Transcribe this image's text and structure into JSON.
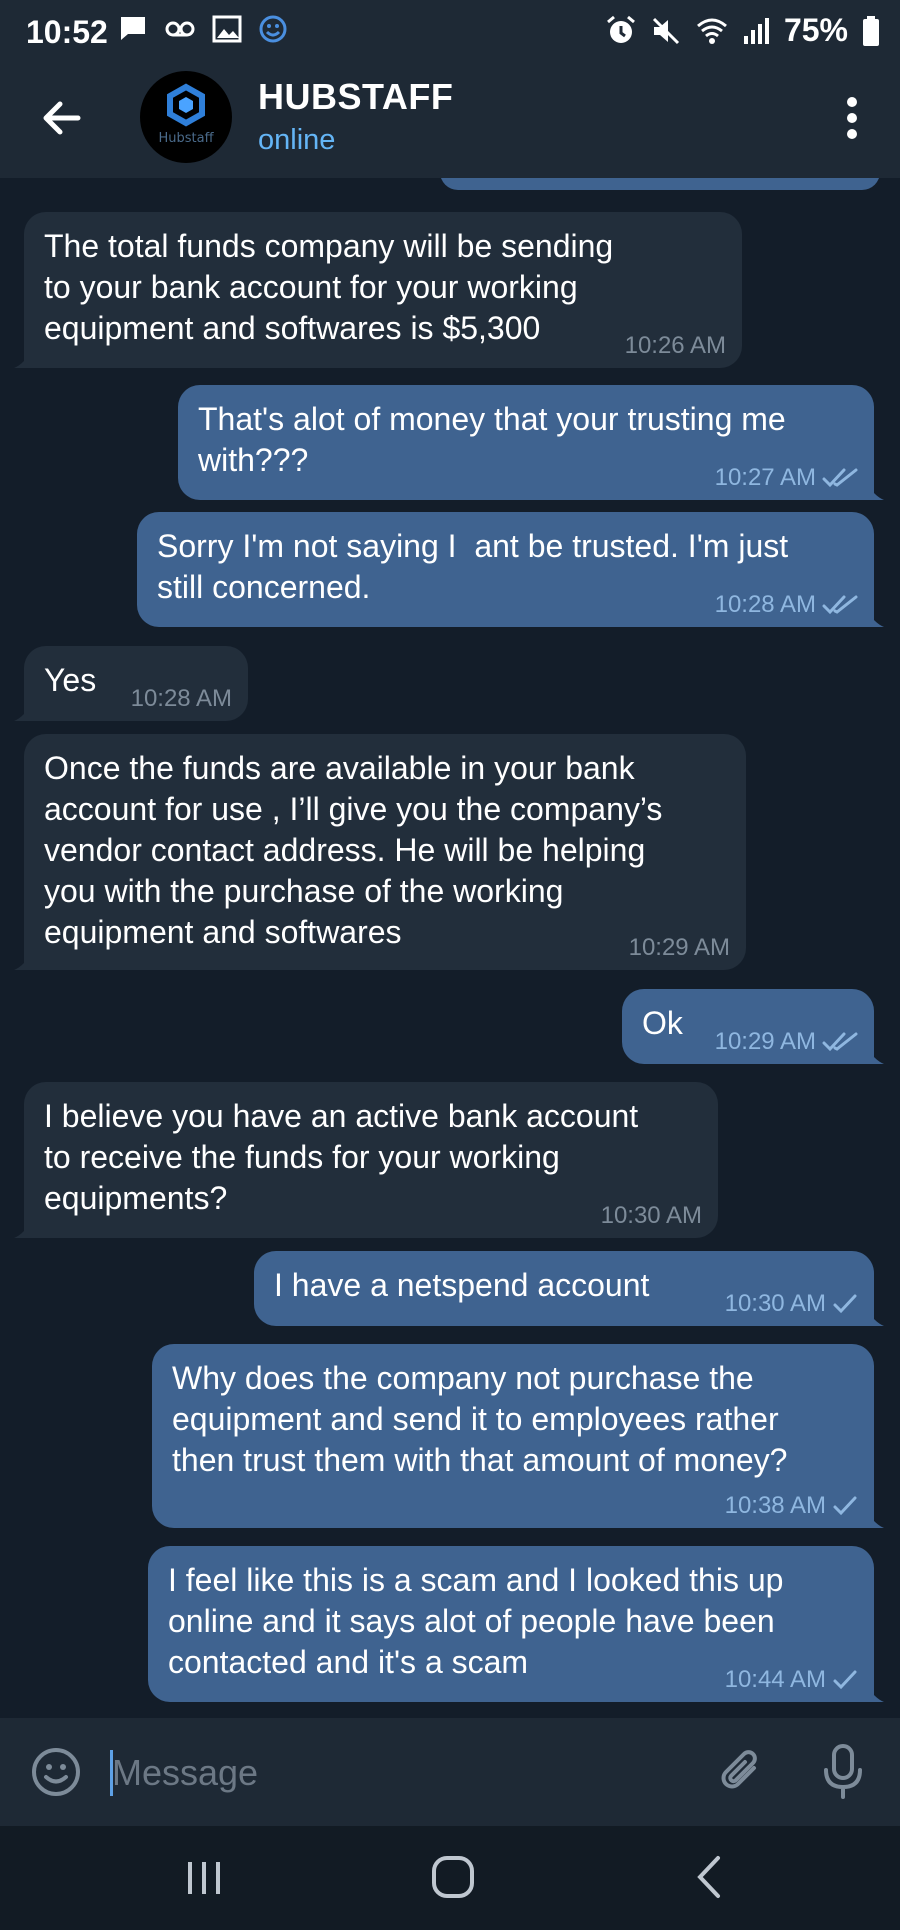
{
  "status_bar": {
    "time": "10:52",
    "battery": "75%",
    "left_icons": [
      "chat-notification-icon",
      "voicemail-icon",
      "gallery-icon",
      "emoji-icon"
    ],
    "right_icons": [
      "alarm-icon",
      "mute-icon",
      "wifi-icon",
      "signal-icon",
      "battery-icon"
    ]
  },
  "header": {
    "title": "HUBSTAFF",
    "status": "online",
    "avatar_text": "Hubstaff"
  },
  "messages": [
    {
      "dir": "in",
      "lines": [
        "The total funds company will be sending",
        "to your bank account for your working",
        "equipment and softwares is $5,300"
      ],
      "time": "10:26 AM",
      "check": ""
    },
    {
      "dir": "out",
      "lines": [
        "That's alot of money that your trusting me",
        "with???"
      ],
      "time": "10:27 AM",
      "check": "double"
    },
    {
      "dir": "out",
      "lines": [
        "Sorry I'm not saying I  ant be trusted. I'm just",
        "still concerned."
      ],
      "time": "10:28 AM",
      "check": "double"
    },
    {
      "dir": "in",
      "lines": [
        "Yes"
      ],
      "time": "10:28 AM",
      "check": ""
    },
    {
      "dir": "in",
      "lines": [
        "Once the funds are available in your bank",
        "account for use , I’ll give you the company’s",
        "vendor contact address. He will be helping",
        "you with the purchase of the working",
        "equipment and softwares"
      ],
      "time": "10:29 AM",
      "check": ""
    },
    {
      "dir": "out",
      "lines": [
        "Ok"
      ],
      "time": "10:29 AM",
      "check": "double"
    },
    {
      "dir": "in",
      "lines": [
        "I believe you have an active bank account",
        "to receive the funds for your working",
        "equipments?"
      ],
      "time": "10:30 AM",
      "check": ""
    },
    {
      "dir": "out",
      "lines": [
        "I have a netspend account"
      ],
      "time": "10:30 AM",
      "check": "single"
    },
    {
      "dir": "out",
      "lines": [
        "Why does the company not purchase the",
        "equipment and send it to employees rather",
        "then trust them with that amount of money?"
      ],
      "time": "10:38 AM",
      "check": "single"
    },
    {
      "dir": "out",
      "lines": [
        "I feel like this is a scam and I looked this up",
        "online and it says alot of people have been",
        "contacted and it's a scam"
      ],
      "time": "10:44 AM",
      "check": "single"
    }
  ],
  "input": {
    "placeholder": "Message"
  },
  "colors": {
    "background": "#131d29",
    "bar": "#1e2935",
    "incoming": "#222e3b",
    "outgoing": "#3f6390",
    "accent": "#64b5f6"
  }
}
